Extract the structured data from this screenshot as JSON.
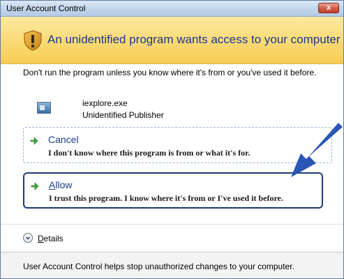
{
  "window": {
    "title": "User Account Control",
    "close_label": "x"
  },
  "banner": {
    "heading": "An unidentified program wants access to your computer",
    "icon": "uac-shield-warning-icon"
  },
  "body": {
    "warning": "Don't run the program unless you know where it's from or you've used it before."
  },
  "program": {
    "name": "iexplore.exe",
    "publisher": "Unidentified Publisher",
    "icon": "program-window-icon"
  },
  "options": {
    "cancel": {
      "title": "Cancel",
      "description": "I don't know where this program is from or what it's for."
    },
    "allow": {
      "title_prefix": "",
      "title_underlined": "A",
      "title_rest": "llow",
      "description": "I trust this program. I know where it's from or I've used it before."
    }
  },
  "details": {
    "underlined": "D",
    "rest": "etails"
  },
  "footer": {
    "text": "User Account Control helps stop unauthorized changes to your computer."
  },
  "colors": {
    "banner": "#f9d870",
    "heading": "#1a3a8c",
    "highlight_border": "#1d3a78",
    "arrow": "#2a56b4",
    "option_arrow": "#3aa83a"
  }
}
